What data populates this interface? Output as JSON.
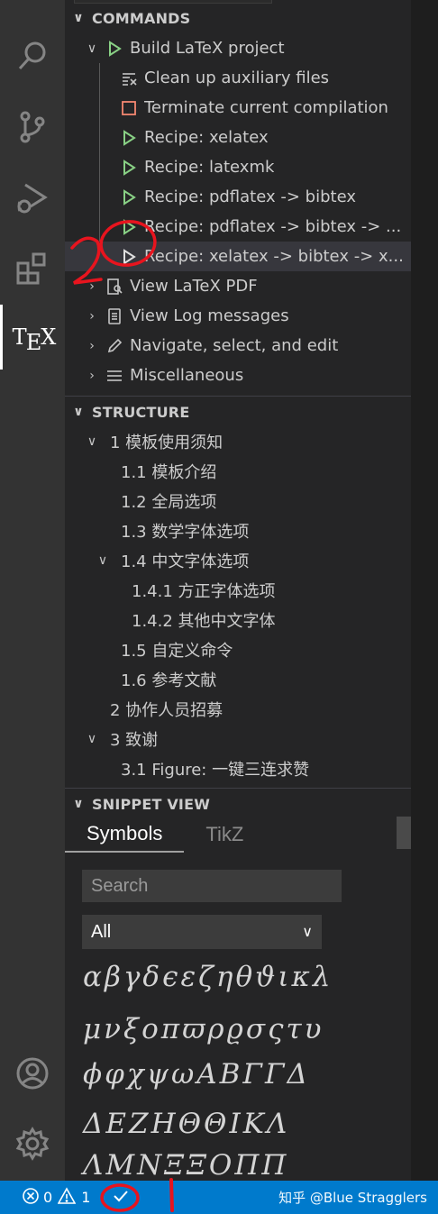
{
  "activity_bar": {
    "items": [
      {
        "name": "search-icon"
      },
      {
        "name": "source-control-icon"
      },
      {
        "name": "run-debug-icon"
      },
      {
        "name": "extensions-icon"
      },
      {
        "name": "tex-icon",
        "label": "TEX"
      },
      {
        "name": "account-icon"
      },
      {
        "name": "settings-gear-icon"
      }
    ]
  },
  "commands": {
    "header": "COMMANDS",
    "items": [
      {
        "label": "Build LaTeX project",
        "icon": "play-icon"
      },
      {
        "label": "Clean up auxiliary files",
        "icon": "clear-all-icon"
      },
      {
        "label": "Terminate current compilation",
        "icon": "stop-icon"
      },
      {
        "label": "Recipe: xelatex",
        "icon": "play-icon"
      },
      {
        "label": "Recipe: latexmk",
        "icon": "play-icon"
      },
      {
        "label": "Recipe: pdflatex -> bibtex",
        "icon": "play-icon"
      },
      {
        "label": "Recipe: pdflatex -> bibtex -> ...",
        "icon": "play-icon"
      },
      {
        "label": "Recipe: xelatex -> bibtex -> x...",
        "icon": "play-outline-icon"
      },
      {
        "label": "View LaTeX PDF",
        "icon": "pdf-view-icon"
      },
      {
        "label": "View Log messages",
        "icon": "log-icon"
      },
      {
        "label": "Navigate, select, and edit",
        "icon": "pencil-icon"
      },
      {
        "label": "Miscellaneous",
        "icon": "menu-icon"
      }
    ]
  },
  "structure": {
    "header": "STRUCTURE",
    "items": [
      "1 模板使用须知",
      "1.1 模板介绍",
      "1.2 全局选项",
      "1.3 数学字体选项",
      "1.4 中文字体选项",
      "1.4.1 方正字体选项",
      "1.4.2 其他中文字体",
      "1.5 自定义命令",
      "1.6 参考文献",
      "2 协作人员招募",
      "3 致谢",
      "3.1 Figure: 一键三连求赞"
    ]
  },
  "snippet": {
    "header": "SNIPPET VIEW",
    "tabs": [
      "Symbols",
      "TikZ"
    ],
    "search_placeholder": "Search",
    "filter_value": "All",
    "symbol_rows": [
      [
        "α",
        "β",
        "γ",
        "δ",
        "ϵ",
        "ε",
        "ζ",
        "η",
        "θ",
        "ϑ",
        "ι",
        "κ",
        "λ"
      ],
      [
        "μ",
        "ν",
        "ξ",
        "ο",
        "π",
        "ϖ",
        "ρ",
        "ϱ",
        "σ",
        "ς",
        "τ",
        "υ"
      ],
      [
        "ϕ",
        "φ",
        "χ",
        "ψ",
        "ω",
        "A",
        "B",
        "Γ",
        "Γ",
        "Δ"
      ],
      [
        "Δ",
        "E",
        "Z",
        "H",
        "Θ",
        "Θ",
        "I",
        "K",
        "Λ"
      ],
      [
        "Λ",
        "M",
        "N",
        "Ξ",
        "Ξ",
        "O",
        "Π",
        "Π"
      ]
    ]
  },
  "status_bar": {
    "errors": "0",
    "warnings": "1",
    "watermark": "知乎 @Blue Stragglers"
  },
  "annotations": {
    "number_label": "2"
  },
  "colors": {
    "accent": "#007acc",
    "play_green": "#89d185",
    "stop_orange": "#f48771",
    "annotation_red": "#e8141e"
  }
}
